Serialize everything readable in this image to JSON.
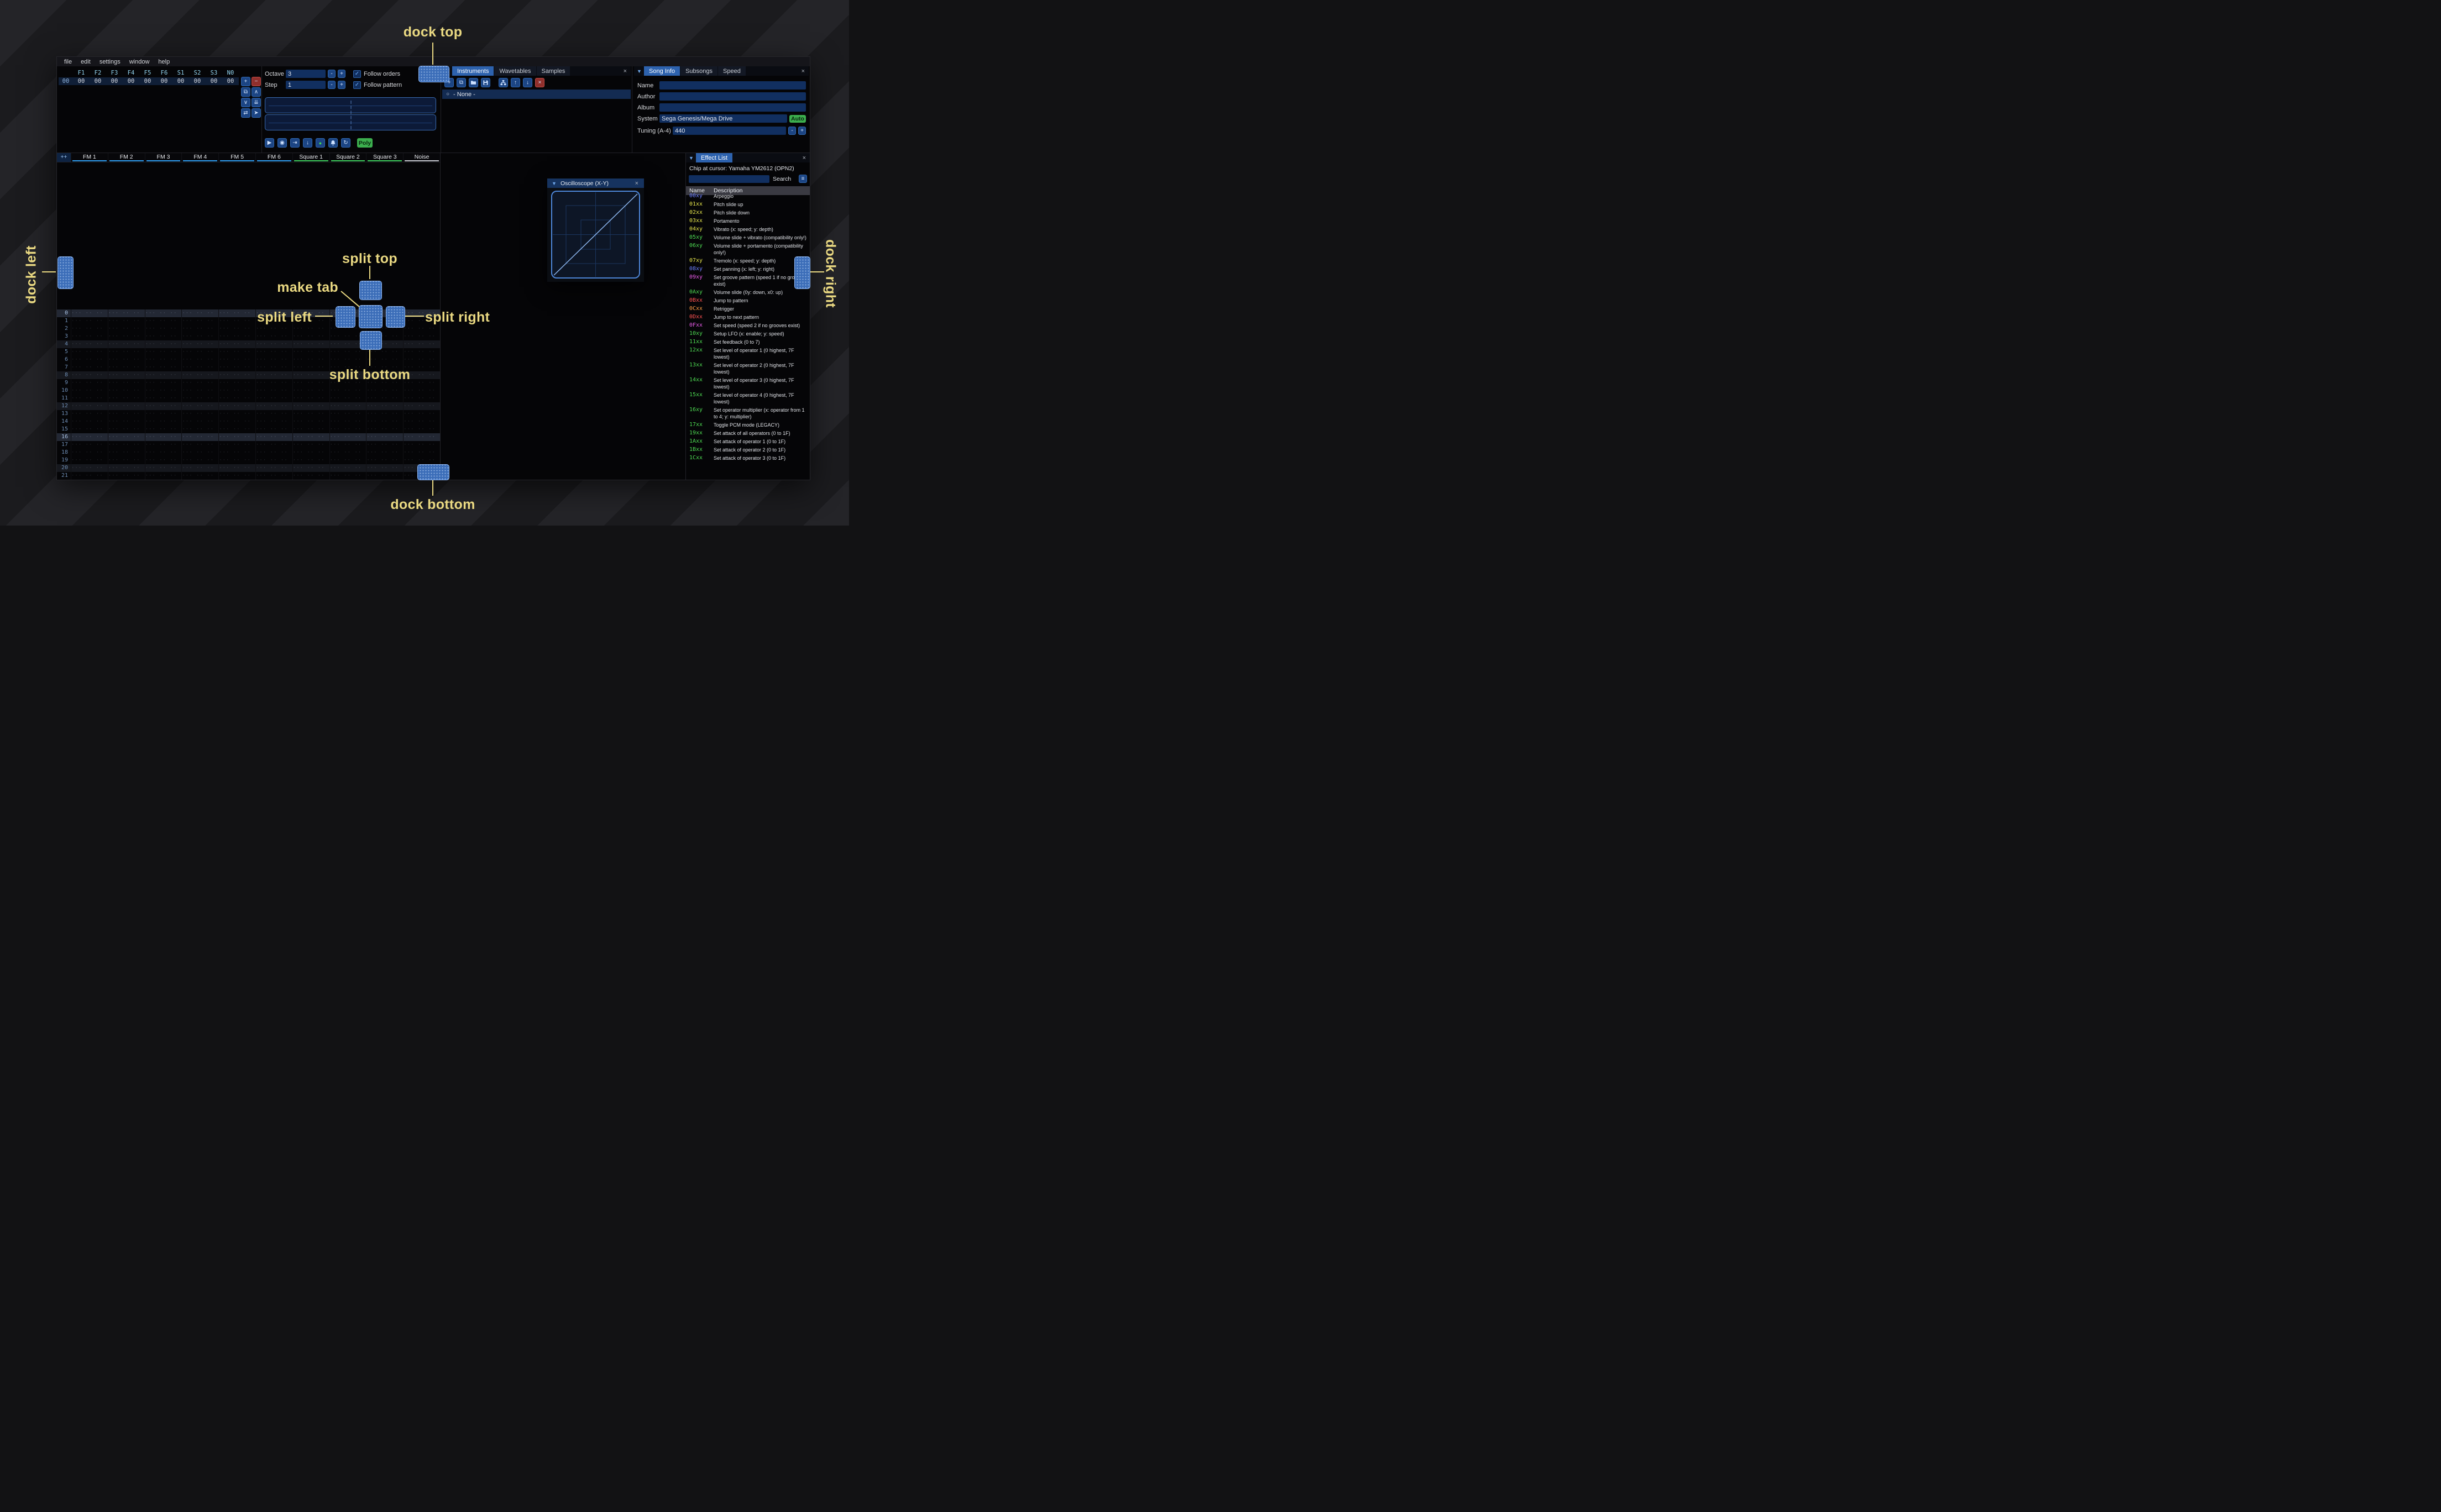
{
  "app": {
    "menu": [
      "file",
      "edit",
      "settings",
      "window",
      "help"
    ]
  },
  "icons": {
    "collapse": "▼",
    "close": "×",
    "check": "✓",
    "radio": "○",
    "menu": "≡",
    "plus": "+",
    "minus": "−",
    "duplicate": "⧉",
    "chev-up": "∧",
    "chev-down": "∨",
    "double-down": "⇊",
    "swap": "⇄",
    "pointer": "➤",
    "up": "↑",
    "down": "↓",
    "play": "▶",
    "play-pattern": "◉",
    "play-cursor": "⇥",
    "step-down": "↓",
    "record": "●",
    "repeat": "↻",
    "folder": "svg:folder",
    "save": "svg:save",
    "tree": "svg:tree",
    "bell": "svg:bell"
  },
  "orders": {
    "channels": [
      "F1",
      "F2",
      "F3",
      "F4",
      "F5",
      "F6",
      "S1",
      "S2",
      "S3",
      "N0"
    ],
    "row_index": "00",
    "row_values": [
      "00",
      "00",
      "00",
      "00",
      "00",
      "00",
      "00",
      "00",
      "00",
      "00"
    ],
    "buttons": [
      {
        "name": "add-order-button",
        "icon": "plus"
      },
      {
        "name": "remove-order-button",
        "icon": "minus",
        "style": "red"
      },
      {
        "name": "duplicate-order-button",
        "icon": "duplicate"
      },
      {
        "name": "move-order-up-button",
        "icon": "chev-up"
      },
      {
        "name": "move-order-down-button",
        "icon": "chev-down"
      },
      {
        "name": "duplicate-order-end-button",
        "icon": "double-down"
      },
      {
        "name": "change-all-orders-button",
        "icon": "swap"
      },
      {
        "name": "order-edit-mode-button",
        "icon": "pointer"
      }
    ]
  },
  "playbar": {
    "octave_label": "Octave",
    "octave_value": "3",
    "step_label": "Step",
    "step_value": "1",
    "minus_label": "-",
    "plus_label": "+",
    "follow_orders_label": "Follow orders",
    "follow_pattern_label": "Follow pattern",
    "poly_label": "Poly",
    "buttons": [
      {
        "name": "play-button",
        "icon": "play"
      },
      {
        "name": "play-pattern-button",
        "icon": "play-pattern"
      },
      {
        "name": "play-from-cursor-button",
        "icon": "play-cursor"
      },
      {
        "name": "step-one-row-button",
        "icon": "step-down"
      },
      {
        "name": "edit-record-toggle",
        "icon": "record",
        "style": "rec"
      },
      {
        "name": "metronome-button",
        "icon": "bell"
      },
      {
        "name": "repeat-pattern-button",
        "icon": "repeat"
      }
    ]
  },
  "instruments": {
    "tabs": [
      "Instruments",
      "Wavetables",
      "Samples"
    ],
    "active_tab": "Instruments",
    "toolbar": [
      {
        "name": "add-instrument-button",
        "icon": "plus"
      },
      {
        "name": "duplicate-instrument-button",
        "icon": "duplicate"
      },
      {
        "name": "open-instrument-button",
        "icon": "folder"
      },
      {
        "name": "save-instrument-button",
        "icon": "save"
      },
      {
        "name": "toggle-folders-button",
        "icon": "tree",
        "gap": true
      },
      {
        "name": "move-instrument-up-button",
        "icon": "up"
      },
      {
        "name": "move-instrument-down-button",
        "icon": "down"
      },
      {
        "name": "delete-instrument-button",
        "icon": "close",
        "style": "red"
      }
    ],
    "list": [
      {
        "label": "- None -",
        "selected": true
      }
    ]
  },
  "song_info": {
    "tabs": [
      "Song Info",
      "Subsongs",
      "Speed"
    ],
    "active_tab": "Song Info",
    "name_label": "Name",
    "name_value": "",
    "author_label": "Author",
    "author_value": "",
    "album_label": "Album",
    "album_value": "",
    "system_label": "System",
    "system_value": "Sega Genesis/Mega Drive",
    "auto_label": "Auto",
    "tuning_label": "Tuning (A-4)",
    "tuning_value": "440",
    "minus_label": "-",
    "plus_label": "+"
  },
  "pattern": {
    "add_button": "++",
    "channels": [
      {
        "name": "FM 1",
        "color": "#2f9ff2"
      },
      {
        "name": "FM 2",
        "color": "#2f9ff2"
      },
      {
        "name": "FM 3",
        "color": "#2f9ff2"
      },
      {
        "name": "FM 4",
        "color": "#2f9ff2"
      },
      {
        "name": "FM 5",
        "color": "#2f9ff2"
      },
      {
        "name": "FM 6",
        "color": "#2f9ff2"
      },
      {
        "name": "Square 1",
        "color": "#3ecf5e"
      },
      {
        "name": "Square 2",
        "color": "#3ecf5e"
      },
      {
        "name": "Square 3",
        "color": "#3ecf5e"
      },
      {
        "name": "Noise",
        "color": "#c9ccd2"
      }
    ],
    "row_count": 22,
    "placeholder": "··· ·· ·· ···"
  },
  "oscilloscope": {
    "title": "Oscilloscope (X-Y)"
  },
  "effect_list": {
    "title": "Effect List",
    "chip_line": "Chip at cursor: Yamaha YM2612 (OPN2)",
    "search_label": "Search",
    "name_header": "Name",
    "desc_header": "Description",
    "palette": {
      "blue": "#6d80ff",
      "yellow": "#e6e64c",
      "green": "#4fdc53",
      "pink": "#ea5dea",
      "red": "#ff5252",
      "orange": "#ff9e45"
    },
    "rows": [
      {
        "code": "00xy",
        "color": "blue",
        "desc": "Arpeggio"
      },
      {
        "code": "01xx",
        "color": "yellow",
        "desc": "Pitch slide up"
      },
      {
        "code": "02xx",
        "color": "yellow",
        "desc": "Pitch slide down"
      },
      {
        "code": "03xx",
        "color": "yellow",
        "desc": "Portamento"
      },
      {
        "code": "04xy",
        "color": "yellow",
        "desc": "Vibrato (x: speed; y: depth)"
      },
      {
        "code": "05xy",
        "color": "green",
        "desc": "Volume slide + vibrato (compatibility only!)"
      },
      {
        "code": "06xy",
        "color": "green",
        "desc": "Volume slide + portamento (compatibility only!)"
      },
      {
        "code": "07xy",
        "color": "yellow",
        "desc": "Tremolo (x: speed; y: depth)"
      },
      {
        "code": "08xy",
        "color": "blue",
        "desc": "Set panning (x: left; y: right)"
      },
      {
        "code": "09xy",
        "color": "pink",
        "desc": "Set groove pattern (speed 1 if no grooves exist)"
      },
      {
        "code": "0Axy",
        "color": "green",
        "desc": "Volume slide (0y: down, x0: up)"
      },
      {
        "code": "0Bxx",
        "color": "red",
        "desc": "Jump to pattern"
      },
      {
        "code": "0Cxx",
        "color": "orange",
        "desc": "Retrigger"
      },
      {
        "code": "0Dxx",
        "color": "red",
        "desc": "Jump to next pattern"
      },
      {
        "code": "0Fxx",
        "color": "pink",
        "desc": "Set speed (speed 2 if no grooves exist)"
      },
      {
        "code": "10xy",
        "color": "green",
        "desc": "Setup LFO (x: enable; y: speed)"
      },
      {
        "code": "11xx",
        "color": "green",
        "desc": "Set feedback (0 to 7)"
      },
      {
        "code": "12xx",
        "color": "green",
        "desc": "Set level of operator 1 (0 highest, 7F lowest)"
      },
      {
        "code": "13xx",
        "color": "green",
        "desc": "Set level of operator 2 (0 highest, 7F lowest)"
      },
      {
        "code": "14xx",
        "color": "green",
        "desc": "Set level of operator 3 (0 highest, 7F lowest)"
      },
      {
        "code": "15xx",
        "color": "green",
        "desc": "Set level of operator 4 (0 highest, 7F lowest)"
      },
      {
        "code": "16xy",
        "color": "green",
        "desc": "Set operator multiplier (x: operator from 1 to 4; y: multiplier)"
      },
      {
        "code": "17xx",
        "color": "green",
        "desc": "Toggle PCM mode (LEGACY)"
      },
      {
        "code": "19xx",
        "color": "green",
        "desc": "Set attack of all operators (0 to 1F)"
      },
      {
        "code": "1Axx",
        "color": "green",
        "desc": "Set attack of operator 1 (0 to 1F)"
      },
      {
        "code": "1Bxx",
        "color": "green",
        "desc": "Set attack of operator 2 (0 to 1F)"
      },
      {
        "code": "1Cxx",
        "color": "green",
        "desc": "Set attack of operator 3 (0 to 1F)"
      }
    ]
  },
  "annotations": {
    "color": "#ead982",
    "dock_top": "dock top",
    "dock_left": "dock left",
    "dock_right": "dock right",
    "dock_bottom": "dock bottom",
    "make_tab": "make tab",
    "split_top": "split top",
    "split_left": "split left",
    "split_right": "split right",
    "split_bottom": "split bottom"
  }
}
